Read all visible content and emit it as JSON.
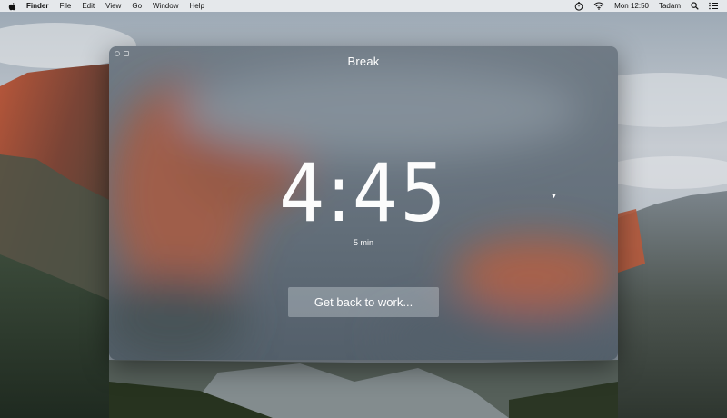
{
  "menubar": {
    "apple_icon": "apple-icon",
    "app_name": "Finder",
    "menus": [
      "File",
      "Edit",
      "View",
      "Go",
      "Window",
      "Help"
    ],
    "clock": "Mon 12:50",
    "user": "Tadam",
    "status_icons": [
      "timer-icon",
      "wifi-icon",
      "search-icon",
      "list-icon"
    ]
  },
  "window": {
    "title": "Break",
    "timer": "4:45",
    "duration": "5 min",
    "dropdown_icon": "triangle-down-icon",
    "cta_label": "Get back to work...",
    "controls": [
      "close-icon",
      "minimize-icon"
    ]
  },
  "colors": {
    "menubar_bg": "#eceef0",
    "window_tint": "#5b6a77",
    "button_bg": "#c9d1d8",
    "text": "#ffffff"
  }
}
